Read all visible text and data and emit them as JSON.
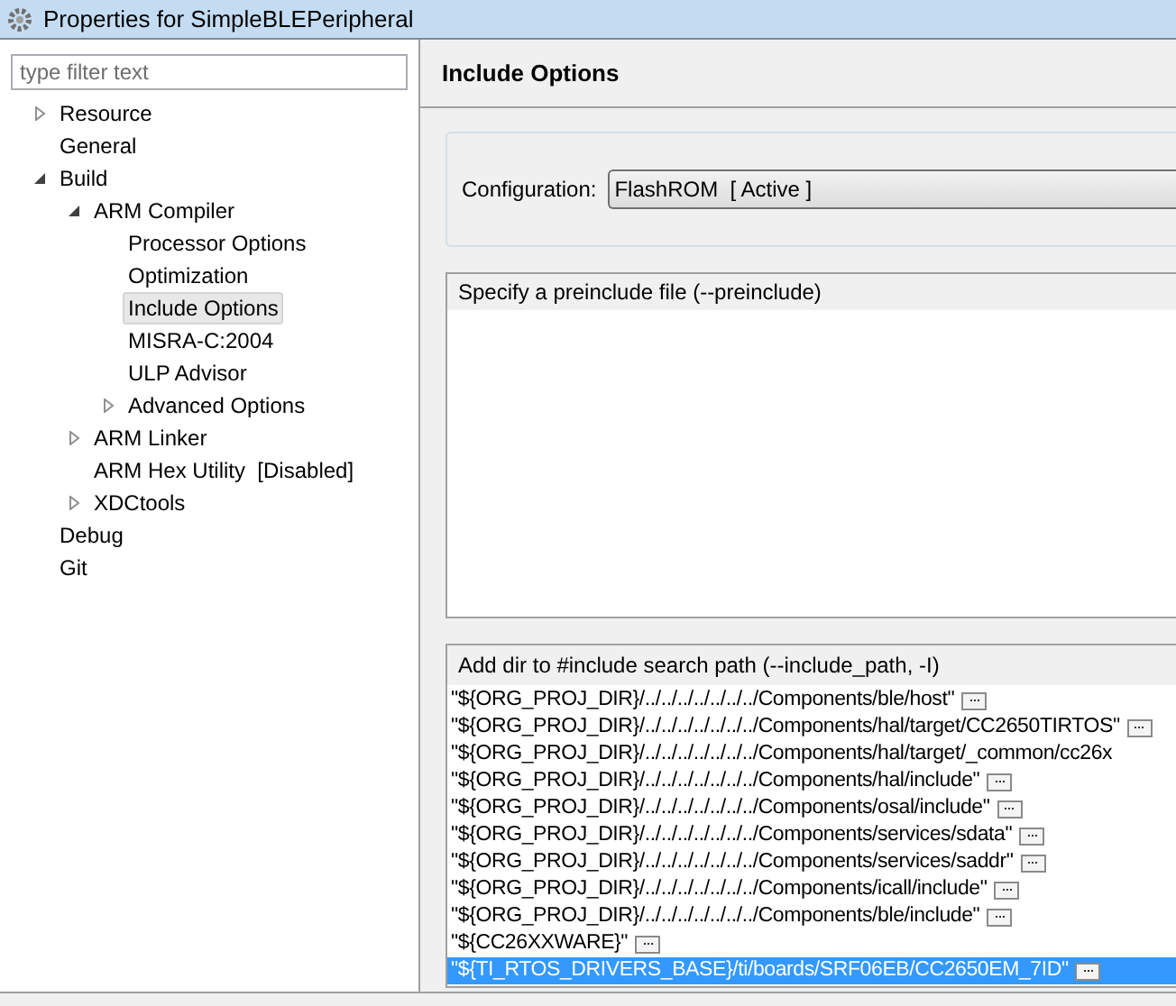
{
  "window": {
    "title": "Properties for SimpleBLEPeripheral"
  },
  "filter": {
    "placeholder": "type filter text"
  },
  "tree": [
    {
      "label": "Resource",
      "expandable": true,
      "expanded": false,
      "selected": false
    },
    {
      "label": "General",
      "selected": false
    },
    {
      "label": "Build",
      "expandable": true,
      "expanded": true,
      "selected": false,
      "children": [
        {
          "label": "ARM Compiler",
          "expandable": true,
          "expanded": true,
          "selected": false,
          "children": [
            {
              "label": "Processor Options",
              "selected": false
            },
            {
              "label": "Optimization",
              "selected": false
            },
            {
              "label": "Include Options",
              "selected": true
            },
            {
              "label": "MISRA-C:2004",
              "selected": false
            },
            {
              "label": "ULP Advisor",
              "selected": false
            },
            {
              "label": "Advanced Options",
              "expandable": true,
              "expanded": false,
              "selected": false
            }
          ]
        },
        {
          "label": "ARM Linker",
          "expandable": true,
          "expanded": false,
          "selected": false
        },
        {
          "label": "ARM Hex Utility  [Disabled]",
          "selected": false
        },
        {
          "label": "XDCtools",
          "expandable": true,
          "expanded": false,
          "selected": false
        }
      ]
    },
    {
      "label": "Debug",
      "selected": false
    },
    {
      "label": "Git",
      "selected": false
    }
  ],
  "page": {
    "title": "Include Options",
    "configuration": {
      "label": "Configuration:",
      "value": "FlashROM  [ Active ]"
    },
    "preinclude": {
      "title": "Specify a preinclude file (--preinclude)"
    },
    "include_path": {
      "title": "Add dir to #include search path (--include_path, -I)",
      "items": [
        {
          "text": "\"${ORG_PROJ_DIR}/../../../../../../../Components/ble/host\"",
          "button": true,
          "selected": false
        },
        {
          "text": "\"${ORG_PROJ_DIR}/../../../../../../../Components/hal/target/CC2650TIRTOS\"",
          "button": true,
          "selected": false
        },
        {
          "text": "\"${ORG_PROJ_DIR}/../../../../../../../Components/hal/target/_common/cc26x",
          "button": false,
          "selected": false
        },
        {
          "text": "\"${ORG_PROJ_DIR}/../../../../../../../Components/hal/include\"",
          "button": true,
          "selected": false
        },
        {
          "text": "\"${ORG_PROJ_DIR}/../../../../../../../Components/osal/include\"",
          "button": true,
          "selected": false
        },
        {
          "text": "\"${ORG_PROJ_DIR}/../../../../../../../Components/services/sdata\"",
          "button": true,
          "selected": false
        },
        {
          "text": "\"${ORG_PROJ_DIR}/../../../../../../../Components/services/saddr\"",
          "button": true,
          "selected": false
        },
        {
          "text": "\"${ORG_PROJ_DIR}/../../../../../../../Components/icall/include\"",
          "button": true,
          "selected": false
        },
        {
          "text": "\"${ORG_PROJ_DIR}/../../../../../../../Components/ble/include\"",
          "button": true,
          "selected": false
        },
        {
          "text": "\"${CC26XXWARE}\"",
          "button": true,
          "selected": false
        },
        {
          "text": "\"${TI_RTOS_DRIVERS_BASE}/ti/boards/SRF06EB/CC2650EM_7ID\"",
          "button": true,
          "selected": true
        }
      ]
    }
  }
}
